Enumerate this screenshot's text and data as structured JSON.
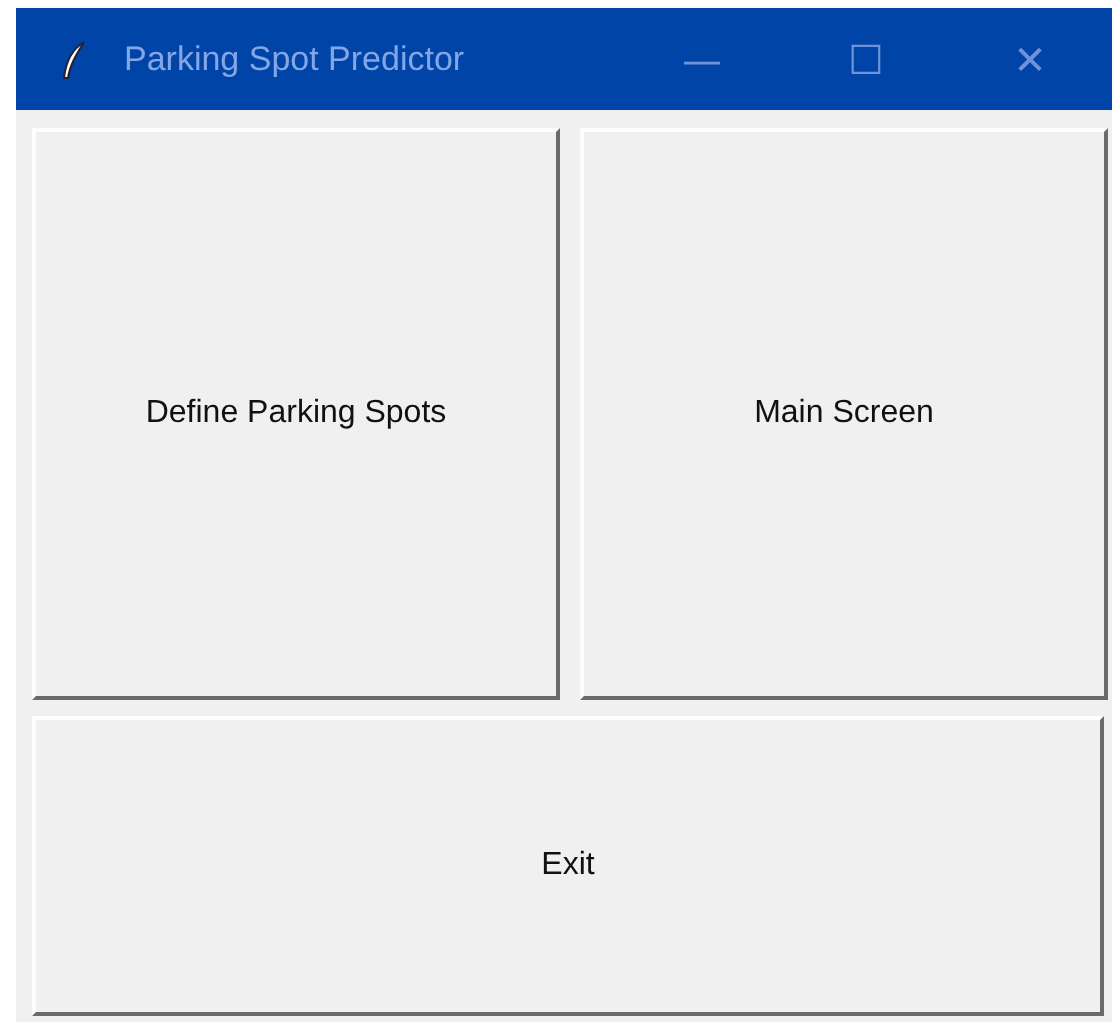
{
  "window": {
    "title": "Parking Spot Predictor",
    "controls": [
      "—",
      "☐",
      "✕"
    ]
  },
  "buttons": [
    {
      "label": "Define Parking Spots"
    },
    {
      "label": "Main Screen"
    },
    {
      "label": "Exit"
    }
  ]
}
